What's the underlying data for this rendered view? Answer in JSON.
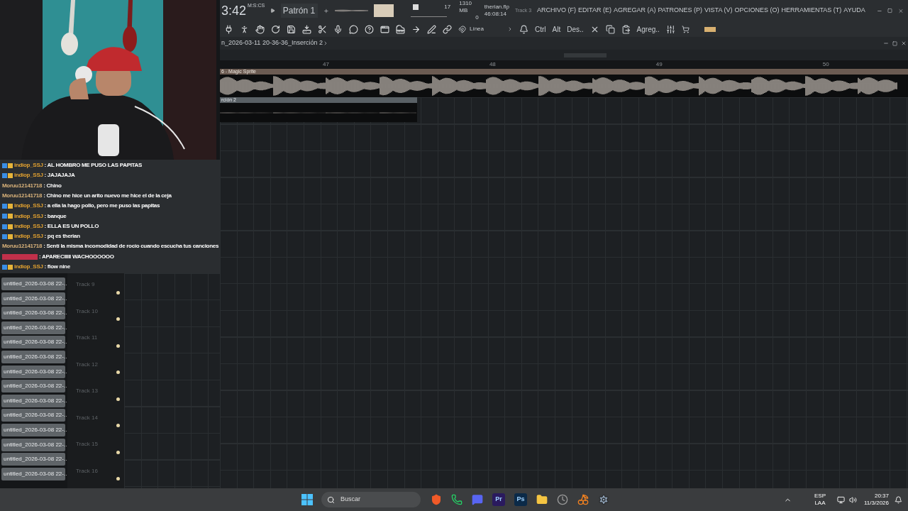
{
  "transport": {
    "time": "3:42",
    "time_unit": "M:S:CS",
    "pattern": "Patrón 1",
    "step": "17",
    "step_slider": {
      "level": 0.06
    },
    "memory": "1310 MB",
    "polyphony": "0",
    "file": "therian.flp",
    "duration": "46:08:14"
  },
  "menu_bar": {
    "track_hint": "Track 3",
    "items": [
      "ARCHIVO (F)",
      "EDITAR (E)",
      "AGREGAR (A)",
      "PATRONES (P)",
      "VISTA (V)",
      "OPCIONES (O)",
      "HERRAMIENTAS (T)",
      "AYUDA"
    ]
  },
  "toolbar": {
    "snap": "Línea",
    "keys": [
      "Ctrl",
      "Alt",
      "Des.."
    ],
    "add": "Agreg.."
  },
  "playlist": {
    "title": "n_2026-03-11 20-36-36_Inserción 2",
    "ruler": [
      "47",
      "48",
      "49",
      "50"
    ],
    "clips": [
      {
        "name": "6 - Magic Sprite"
      },
      {
        "name": "rción 2"
      }
    ],
    "clip_buttons": [
      "untitled_2026-03-08 22-...",
      "untitled_2026-03-08 22-...",
      "untitled_2026-03-08 22-...",
      "untitled_2026-03-08 22-...",
      "untitled_2026-03-08 22-...",
      "untitled_2026-03-08 22-...",
      "untitled_2026-03-08 22-...",
      "untitled_2026-03-08 22-...",
      "untitled_2026-03-08 22-...",
      "untitled_2026-03-08 22-...",
      "untitled_2026-03-08 22-...",
      "untitled_2026-03-08 22-...",
      "untitled_2026-03-08 22-...",
      "untitled_2026-03-08 22-..."
    ],
    "tracks": [
      "Track 9",
      "Track 10",
      "Track 11",
      "Track 12",
      "Track 13",
      "Track 14",
      "Track 15",
      "Track 16"
    ]
  },
  "chat": [
    {
      "user": "indiop_SSJ",
      "badges": true,
      "color": "#e0a030",
      "message": ": AL HOMBRO ME PUSO LAS PAPITAS"
    },
    {
      "user": "indiop_SSJ",
      "badges": true,
      "color": "#e0a030",
      "message": ": JAJAJAJA"
    },
    {
      "user": "Moruu12141718",
      "badges": false,
      "color": "#d9b27a",
      "message": ": Chino"
    },
    {
      "user": "Moruu12141718",
      "badges": false,
      "color": "#d9b27a",
      "message": ": Chino me hice un arito nuevo me hice el de la ceja"
    },
    {
      "user": "indiop_SSJ",
      "badges": true,
      "color": "#e0a030",
      "message": ": a ella la hago pollo, pero me puso las papitas"
    },
    {
      "user": "indiop_SSJ",
      "badges": true,
      "color": "#e0a030",
      "message": ": banque"
    },
    {
      "user": "indiop_SSJ",
      "badges": true,
      "color": "#e0a030",
      "message": ": ELLA ES UN POLLO"
    },
    {
      "user": "indiop_SSJ",
      "badges": true,
      "color": "#e0a030",
      "message": ": pq es therian"
    },
    {
      "user": "Moruu12141718",
      "badges": false,
      "color": "#d9b27a",
      "message": ": Sentí la misma incomodidad de rocío cuando escucha tus canciones"
    },
    {
      "badges": false,
      "color": "#c0304a",
      "message": ": APARECIIIII WACHOOOOOO"
    },
    {
      "user": "indiop_SSJ",
      "badges": true,
      "color": "#e0a030",
      "message": ": flow nine"
    }
  ],
  "taskbar": {
    "search": "Buscar",
    "apps": [
      {
        "kind": "shield",
        "color": "#f05a28"
      },
      {
        "kind": "phone",
        "color": "#25d366"
      },
      {
        "kind": "chat",
        "color": "#5865f2"
      },
      {
        "kind": "letters",
        "label": "Pr",
        "color": "#2a1a5e"
      },
      {
        "kind": "letters",
        "label": "Ps",
        "color": "#0b2a48"
      },
      {
        "kind": "folder",
        "color": "#f5c542"
      },
      {
        "kind": "clock",
        "color": "#9a9a9a"
      },
      {
        "kind": "fruit",
        "color": "#f08020"
      },
      {
        "kind": "gear",
        "color": "#8fa3b8"
      }
    ],
    "language": "ESP",
    "layout": "LAA",
    "time": "20:37",
    "date": "11/3/2026"
  }
}
